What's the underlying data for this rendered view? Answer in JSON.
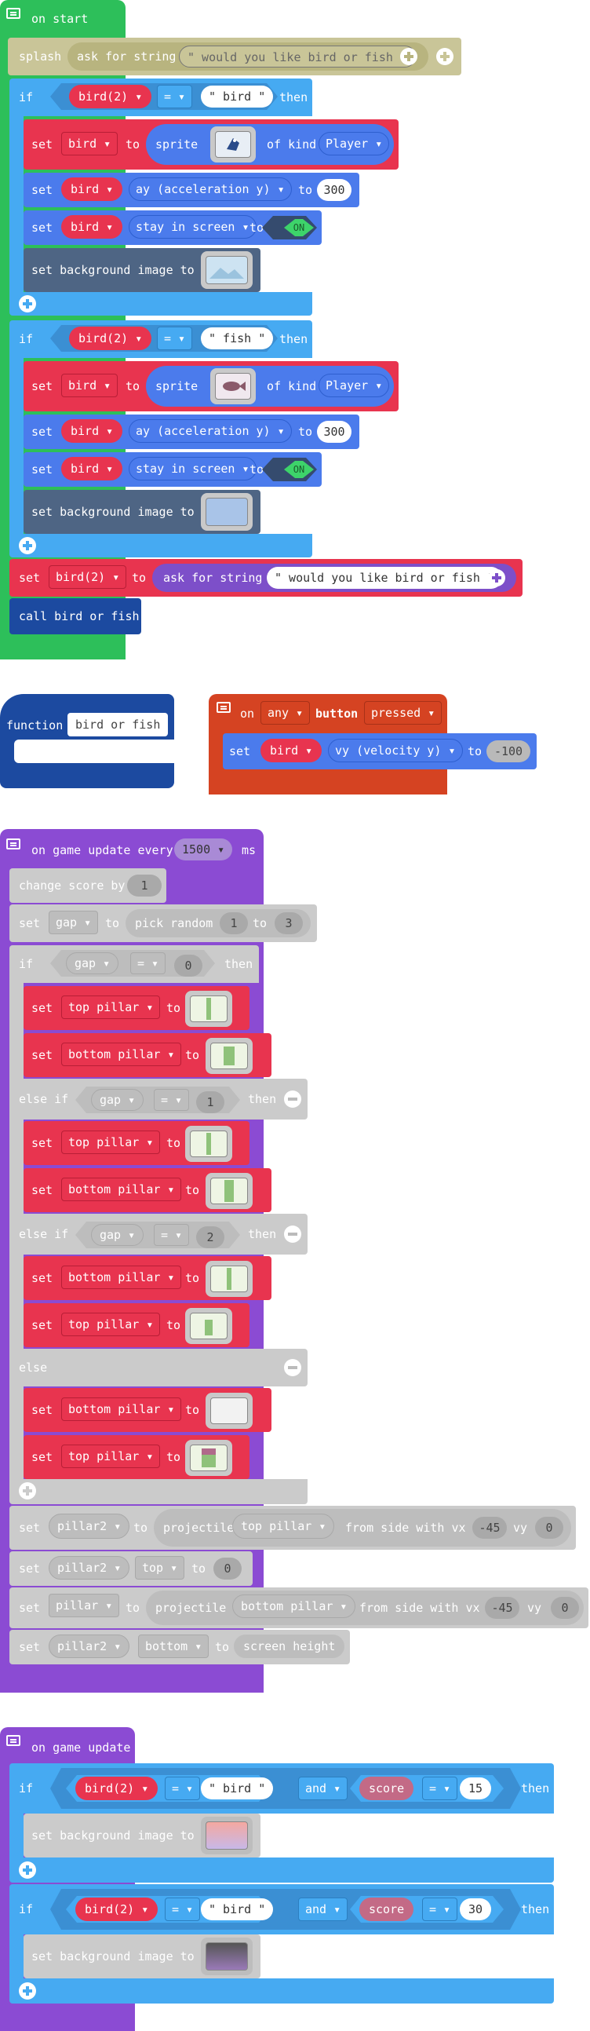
{
  "colors": {
    "events_green": "#2dbf5a",
    "logic_blue": "#46aaf2",
    "sprite_blue": "#4b7bec",
    "variable_red": "#e8344f",
    "function_navy": "#1c4aa0",
    "controller_red": "#d54322",
    "game_purple": "#8b4bd3",
    "disabled_gray": "#cbcbcb",
    "splash_khaki": "#c9c598",
    "scene_slate": "#4e6584"
  },
  "on_start": {
    "title": "on start",
    "splash": {
      "label": "splash",
      "ask_label": "ask for string",
      "prompt": "\" would you like bird or fish \""
    },
    "if1": {
      "if_label": "if",
      "var": "bird(2)",
      "op": "=",
      "value": "\" bird \"",
      "then_label": "then",
      "set1": {
        "set": "set",
        "var": "bird",
        "to": "to",
        "sprite": "sprite",
        "of_kind": "of kind",
        "kind": "Player",
        "icon": "bird-sprite-icon"
      },
      "set2": {
        "set": "set",
        "var": "bird",
        "prop": "ay (acceleration y)",
        "to": "to",
        "value": "300"
      },
      "set3": {
        "set": "set",
        "var": "bird",
        "prop": "stay in screen",
        "to": "to",
        "toggle": "ON"
      },
      "bg": {
        "label": "set background image to"
      }
    },
    "if2": {
      "if_label": "if",
      "var": "bird(2)",
      "op": "=",
      "value": "\" fish \"",
      "then_label": "then",
      "set1": {
        "set": "set",
        "var": "bird",
        "to": "to",
        "sprite": "sprite",
        "of_kind": "of kind",
        "kind": "Player",
        "icon": "fish-sprite-icon"
      },
      "set2": {
        "set": "set",
        "var": "bird",
        "prop": "ay (acceleration y)",
        "to": "to",
        "value": "300"
      },
      "set3": {
        "set": "set",
        "var": "bird",
        "prop": "stay in screen",
        "to": "to",
        "toggle": "ON"
      },
      "bg": {
        "label": "set background image to"
      }
    },
    "set_var": {
      "set": "set",
      "var": "bird(2)",
      "to": "to",
      "ask_label": "ask for string",
      "prompt": "\" would you like bird or fish \""
    },
    "call": {
      "label": "call bird or fish"
    }
  },
  "function_block": {
    "label": "function",
    "name": "bird or fish"
  },
  "on_button": {
    "on": "on",
    "which": "any",
    "button": "button",
    "event": "pressed",
    "set": "set",
    "var": "bird",
    "prop": "vy (velocity y)",
    "to": "to",
    "value": "-100"
  },
  "game_update_every": {
    "title": "on game update every",
    "interval": "1500",
    "unit": "ms",
    "change_score": {
      "label": "change score by",
      "value": "1"
    },
    "set_gap": {
      "set": "set",
      "var": "gap",
      "to": "to",
      "pick": "pick random",
      "min": "1",
      "to2": "to",
      "max": "3"
    },
    "if_gap": {
      "if": "if",
      "var": "gap",
      "op": "=",
      "value": "0",
      "then": "then"
    },
    "branch0": [
      {
        "set": "set",
        "var": "top pillar",
        "to": "to"
      },
      {
        "set": "set",
        "var": "bottom pillar",
        "to": "to"
      }
    ],
    "elseif1": {
      "label": "else if",
      "var": "gap",
      "op": "=",
      "value": "1",
      "then": "then"
    },
    "branch1": [
      {
        "set": "set",
        "var": "top pillar",
        "to": "to"
      },
      {
        "set": "set",
        "var": "bottom pillar",
        "to": "to"
      }
    ],
    "elseif2": {
      "label": "else if",
      "var": "gap",
      "op": "=",
      "value": "2",
      "then": "then"
    },
    "branch2": [
      {
        "set": "set",
        "var": "bottom pillar",
        "to": "to"
      },
      {
        "set": "set",
        "var": "top pillar",
        "to": "to"
      }
    ],
    "else_label": "else",
    "branch3": [
      {
        "set": "set",
        "var": "bottom pillar",
        "to": "to"
      },
      {
        "set": "set",
        "var": "top pillar",
        "to": "to"
      }
    ],
    "proj1": {
      "set": "set",
      "var": "pillar2",
      "to": "to",
      "projectile": "projectile",
      "image": "top pillar",
      "from": "from side with vx",
      "vx": "-45",
      "vy_label": "vy",
      "vy": "0"
    },
    "set_top": {
      "set": "set",
      "var": "pillar2",
      "prop": "top",
      "to": "to",
      "value": "0"
    },
    "proj2": {
      "set": "set",
      "var": "pillar",
      "to": "to",
      "projectile": "projectile",
      "image": "bottom pillar",
      "from": "from side with vx",
      "vx": "-45",
      "vy_label": "vy",
      "vy": "0"
    },
    "set_bottom": {
      "set": "set",
      "var": "pillar2",
      "prop": "bottom",
      "to": "to",
      "value": "screen height"
    }
  },
  "game_update": {
    "title": "on game update",
    "if1": {
      "if": "if",
      "var": "bird(2)",
      "op": "=",
      "value": "\" bird \"",
      "and": "and",
      "var2": "score",
      "op2": "=",
      "value2": "15",
      "then": "then",
      "bg": "set background image to"
    },
    "if2": {
      "if": "if",
      "var": "bird(2)",
      "op": "=",
      "value": "\" bird \"",
      "and": "and",
      "var2": "score",
      "op2": "=",
      "value2": "30",
      "then": "then",
      "bg": "set background image to"
    }
  }
}
